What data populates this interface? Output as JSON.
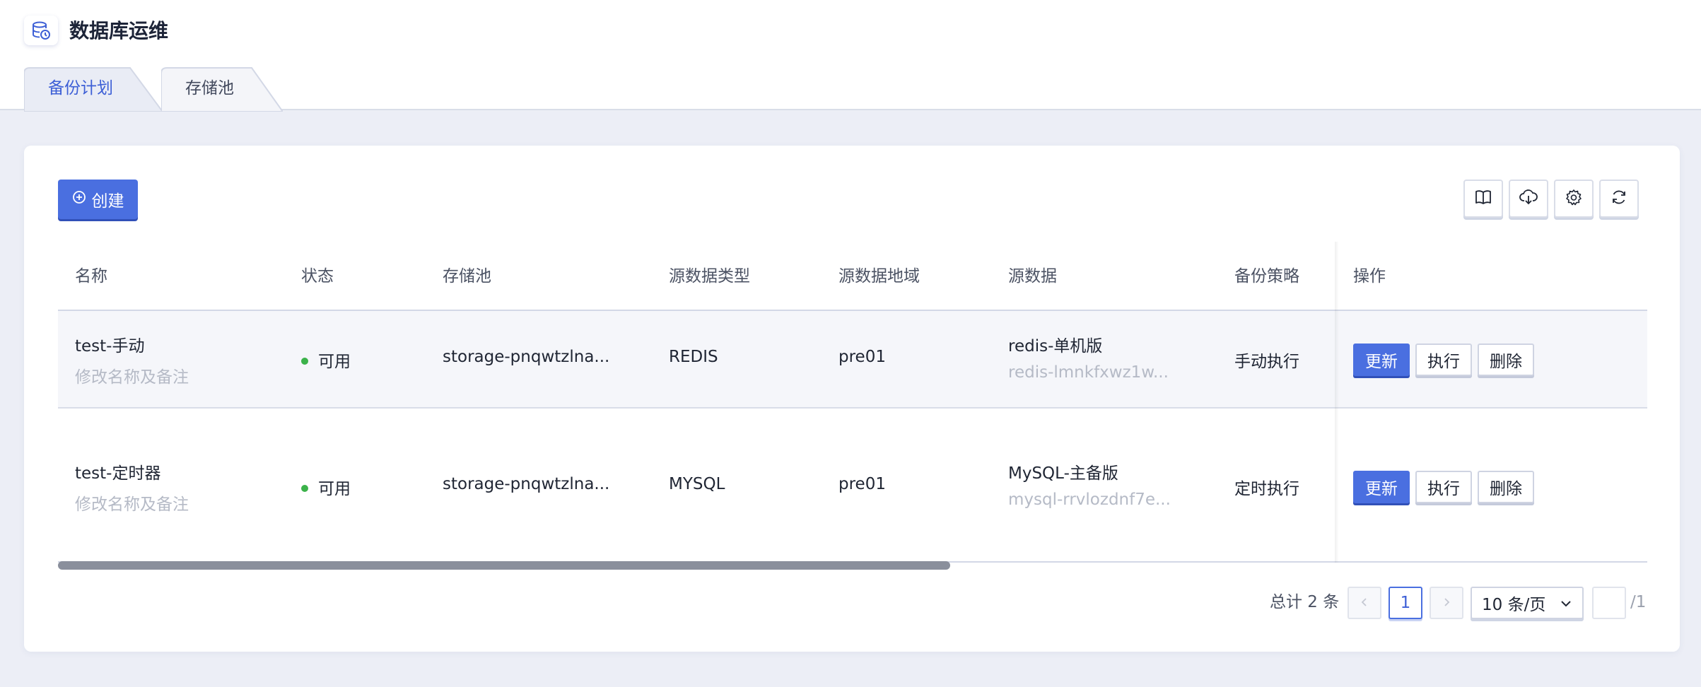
{
  "header": {
    "icon": "database-clock-icon",
    "title": "数据库运维"
  },
  "tabs": [
    {
      "label": "备份计划",
      "active": true
    },
    {
      "label": "存储池",
      "active": false
    }
  ],
  "toolbar": {
    "create_label": "创建",
    "create_icon": "plus-circle-icon",
    "tools": [
      "book-icon",
      "cloud-download-icon",
      "gear-icon",
      "refresh-icon"
    ]
  },
  "table": {
    "columns": [
      "名称",
      "状态",
      "存储池",
      "源数据类型",
      "源数据地域",
      "源数据",
      "备份策略",
      "操作"
    ],
    "rows": [
      {
        "name": "test-手动",
        "name_hint": "修改名称及备注",
        "status": "可用",
        "pool": "storage-pnqwtzlna...",
        "type": "REDIS",
        "region": "pre01",
        "source": "redis-单机版",
        "source_id": "redis-lmnkfxwz1w...",
        "policy": "手动执行",
        "actions": [
          "更新",
          "执行",
          "删除"
        ]
      },
      {
        "name": "test-定时器",
        "name_hint": "修改名称及备注",
        "status": "可用",
        "pool": "storage-pnqwtzlna...",
        "type": "MYSQL",
        "region": "pre01",
        "source": "MySQL-主备版",
        "source_id": "mysql-rrvlozdnf7e...",
        "policy": "定时执行",
        "actions": [
          "更新",
          "执行",
          "删除"
        ]
      }
    ]
  },
  "pagination": {
    "total_text": "总计 2 条",
    "current_page": "1",
    "page_size": "10 条/页",
    "total_pages": "/1"
  },
  "colors": {
    "primary": "#4a6fe0",
    "status_ok": "#3bb24a"
  }
}
